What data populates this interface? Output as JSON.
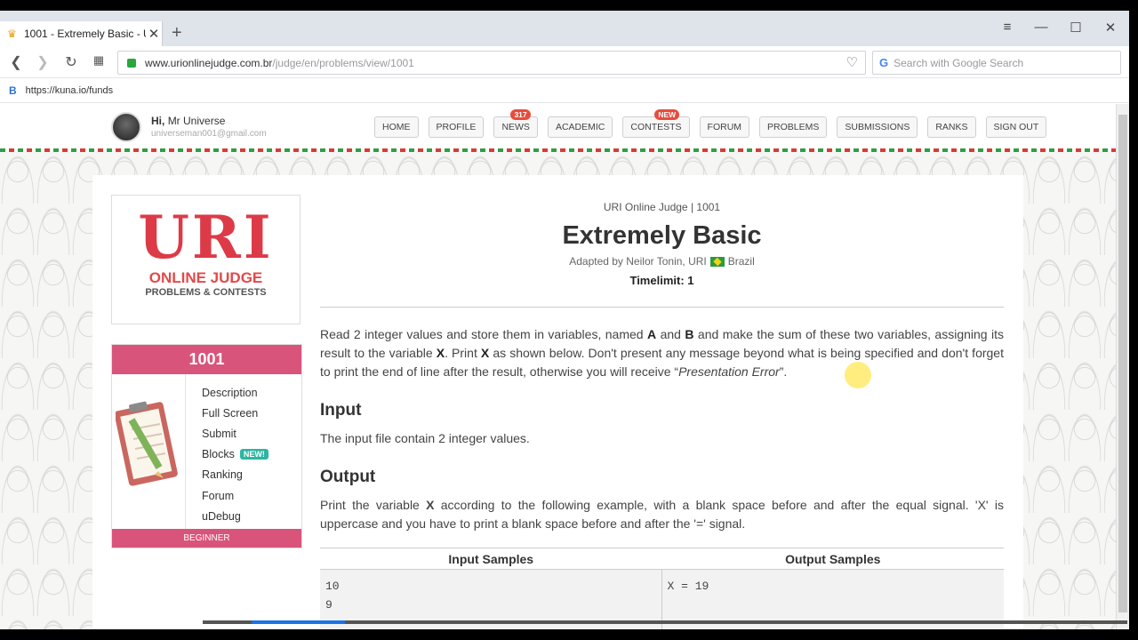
{
  "browser": {
    "tab_title": "1001 - Extremely Basic - U",
    "url_domain": "www.urionlinejudge.com.br",
    "url_path": "/judge/en/problems/view/1001",
    "search_placeholder": "Search with Google Search",
    "bookmark_label": "https://kuna.io/funds"
  },
  "header": {
    "greeting_prefix": "Hi,",
    "user_name": "Mr Universe",
    "email": "universeman001@gmail.com",
    "menu": [
      {
        "label": "HOME"
      },
      {
        "label": "PROFILE"
      },
      {
        "label": "NEWS",
        "badge": "317"
      },
      {
        "label": "ACADEMIC"
      },
      {
        "label": "CONTESTS",
        "badge": "NEW"
      },
      {
        "label": "FORUM"
      },
      {
        "label": "PROBLEMS"
      },
      {
        "label": "SUBMISSIONS"
      },
      {
        "label": "RANKS"
      },
      {
        "label": "SIGN OUT"
      }
    ]
  },
  "logo": {
    "uri": "URI",
    "online_judge": "ONLINE JUDGE",
    "problems_contests": "PROBLEMS & CONTESTS"
  },
  "problem_card": {
    "number": "1001",
    "links": [
      "Description",
      "Full Screen",
      "Submit",
      "Blocks",
      "Ranking",
      "Forum",
      "uDebug"
    ],
    "blocks_badge": "NEW!",
    "level": "BEGINNER"
  },
  "problem": {
    "breadcrumb": "URI Online Judge | 1001",
    "title": "Extremely Basic",
    "adapted_by": "Adapted by Neilor Tonin, URI",
    "country": "Brazil",
    "timelimit": "Timelimit: 1",
    "desc_1": "Read 2 integer values and store them in variables, named ",
    "var_a": "A",
    "desc_and": " and ",
    "var_b": "B",
    "desc_2": " and make the sum of these two variables, assigning its result to the variable ",
    "var_x": "X",
    "desc_3": ". Print ",
    "desc_4": " as shown below. Don't present any message beyond what is being specified and don't forget to print the end of line after the result, otherwise you will receive “",
    "desc_pe": "Presentation Error",
    "desc_5": "”.",
    "input_heading": "Input",
    "input_text": "The input file contain 2 integer values.",
    "output_heading": "Output",
    "output_1": "Print the variable ",
    "output_2": " according to the following example, with a blank space before and after the equal signal. 'X' is uppercase and you have to print a blank space before and after the '=' signal.",
    "samples": {
      "input_header": "Input Samples",
      "output_header": "Output Samples",
      "input_lines": [
        "10",
        "9"
      ],
      "output_lines": [
        "X = 19"
      ]
    }
  }
}
